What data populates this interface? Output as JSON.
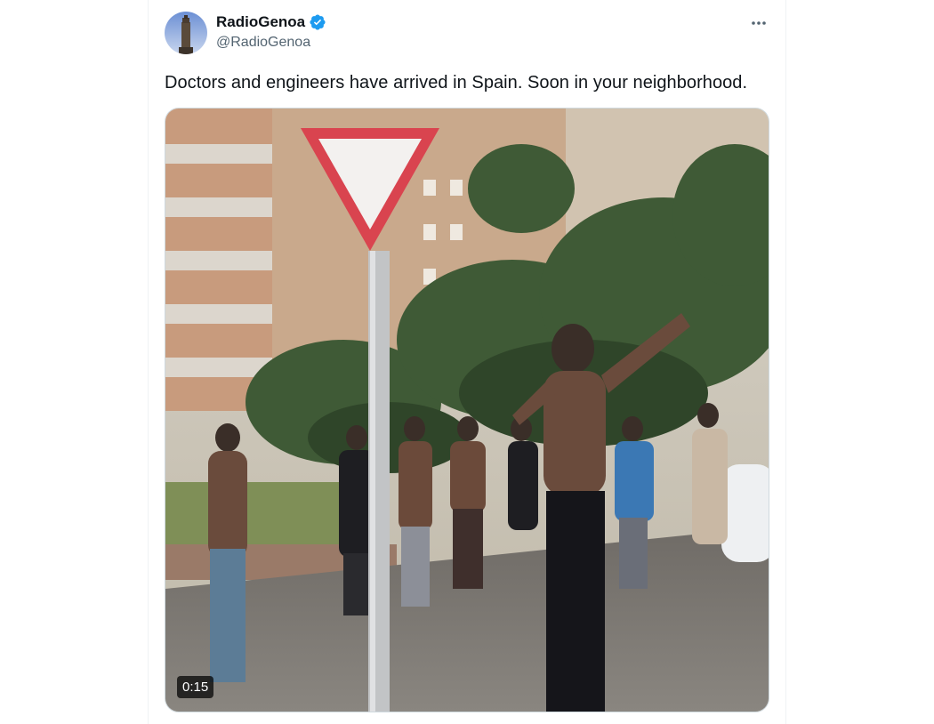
{
  "tweet": {
    "author": {
      "display_name": "RadioGenoa",
      "handle": "@RadioGenoa",
      "verified": true,
      "verified_badge_color": "#1d9bf0",
      "avatar_icon": "tower-avatar-icon"
    },
    "more_menu_icon": "more-horizontal-icon",
    "text": "Doctors and engineers have arrived in Spain. Soon in your neighborhood.",
    "media": {
      "type": "video",
      "duration": "0:15"
    }
  }
}
